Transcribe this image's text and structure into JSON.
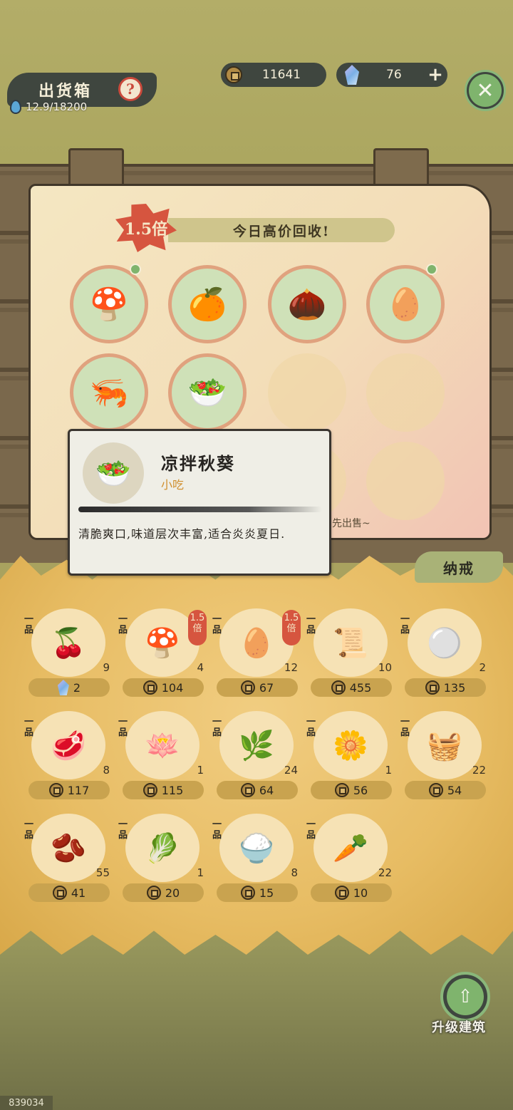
{
  "header": {
    "title": "出货箱",
    "help_icon": "?",
    "capacity": "12.9/18200",
    "coins": "11641",
    "gems": "76",
    "plus_label": "+",
    "close_label": "✕"
  },
  "high_price": {
    "multiplier": "1.5倍",
    "title": "今日高价回收!",
    "items": [
      {
        "icon": "mushroom-icon",
        "glyph": "🍄",
        "tagged": true
      },
      {
        "icon": "orange-icon",
        "glyph": "🍊",
        "tagged": false
      },
      {
        "icon": "seeds-icon",
        "glyph": "🌰",
        "tagged": false
      },
      {
        "icon": "eggs-on-leaf-icon",
        "glyph": "🥚",
        "tagged": true
      },
      {
        "icon": "shrimp-on-leaf-icon",
        "glyph": "🦐",
        "tagged": false
      },
      {
        "icon": "okra-salad-icon",
        "glyph": "🥗",
        "tagged": false
      }
    ],
    "hint": "先出售~"
  },
  "tooltip": {
    "name": "凉拌秋葵",
    "category": "小吃",
    "description": "清脆爽口,味道层次丰富,适合炎炎夏日.",
    "icon": "okra-salad-icon"
  },
  "inventory": {
    "tab_label": "纳戒",
    "grade": "一品",
    "boost_label": "1.5倍",
    "items": [
      {
        "icon": "red-berries-icon",
        "glyph": "🍒",
        "count": "9",
        "price": "2",
        "currency": "gem",
        "boost": false
      },
      {
        "icon": "mushroom-icon",
        "glyph": "🍄",
        "count": "4",
        "price": "104",
        "currency": "coin",
        "boost": true
      },
      {
        "icon": "eggs-on-leaf-icon",
        "glyph": "🥚",
        "count": "12",
        "price": "67",
        "currency": "coin",
        "boost": true
      },
      {
        "icon": "cloth-roll-icon",
        "glyph": "📜",
        "count": "10",
        "price": "455",
        "currency": "coin",
        "boost": false
      },
      {
        "icon": "pearl-icon",
        "glyph": "⚪",
        "count": "2",
        "price": "135",
        "currency": "coin",
        "boost": false
      },
      {
        "icon": "meat-icon",
        "glyph": "🥩",
        "count": "8",
        "price": "117",
        "currency": "coin",
        "boost": false
      },
      {
        "icon": "lotus-icon",
        "glyph": "🪷",
        "count": "1",
        "price": "115",
        "currency": "coin",
        "boost": false
      },
      {
        "icon": "green-noodles-icon",
        "glyph": "🌿",
        "count": "24",
        "price": "64",
        "currency": "coin",
        "boost": false
      },
      {
        "icon": "white-flower-icon",
        "glyph": "🌼",
        "count": "1",
        "price": "56",
        "currency": "coin",
        "boost": false
      },
      {
        "icon": "tofu-basket-icon",
        "glyph": "🧺",
        "count": "22",
        "price": "54",
        "currency": "coin",
        "boost": false
      },
      {
        "icon": "soybean-icon",
        "glyph": "🫘",
        "count": "55",
        "price": "41",
        "currency": "coin",
        "boost": false
      },
      {
        "icon": "bok-choy-icon",
        "glyph": "🥬",
        "count": "1",
        "price": "20",
        "currency": "coin",
        "boost": false
      },
      {
        "icon": "rice-grains-icon",
        "glyph": "🍚",
        "count": "8",
        "price": "15",
        "currency": "coin",
        "boost": false
      },
      {
        "icon": "radish-icon",
        "glyph": "🥕",
        "count": "22",
        "price": "10",
        "currency": "coin",
        "boost": false
      }
    ]
  },
  "upgrade": {
    "label": "升级建筑",
    "icon": "upgrade-building-icon"
  },
  "build_id": "839034",
  "colors": {
    "accent_red": "#d6553f",
    "dark_panel": "#3f463f",
    "jade_green": "#7fb46d",
    "straw": "#e7bc63"
  }
}
